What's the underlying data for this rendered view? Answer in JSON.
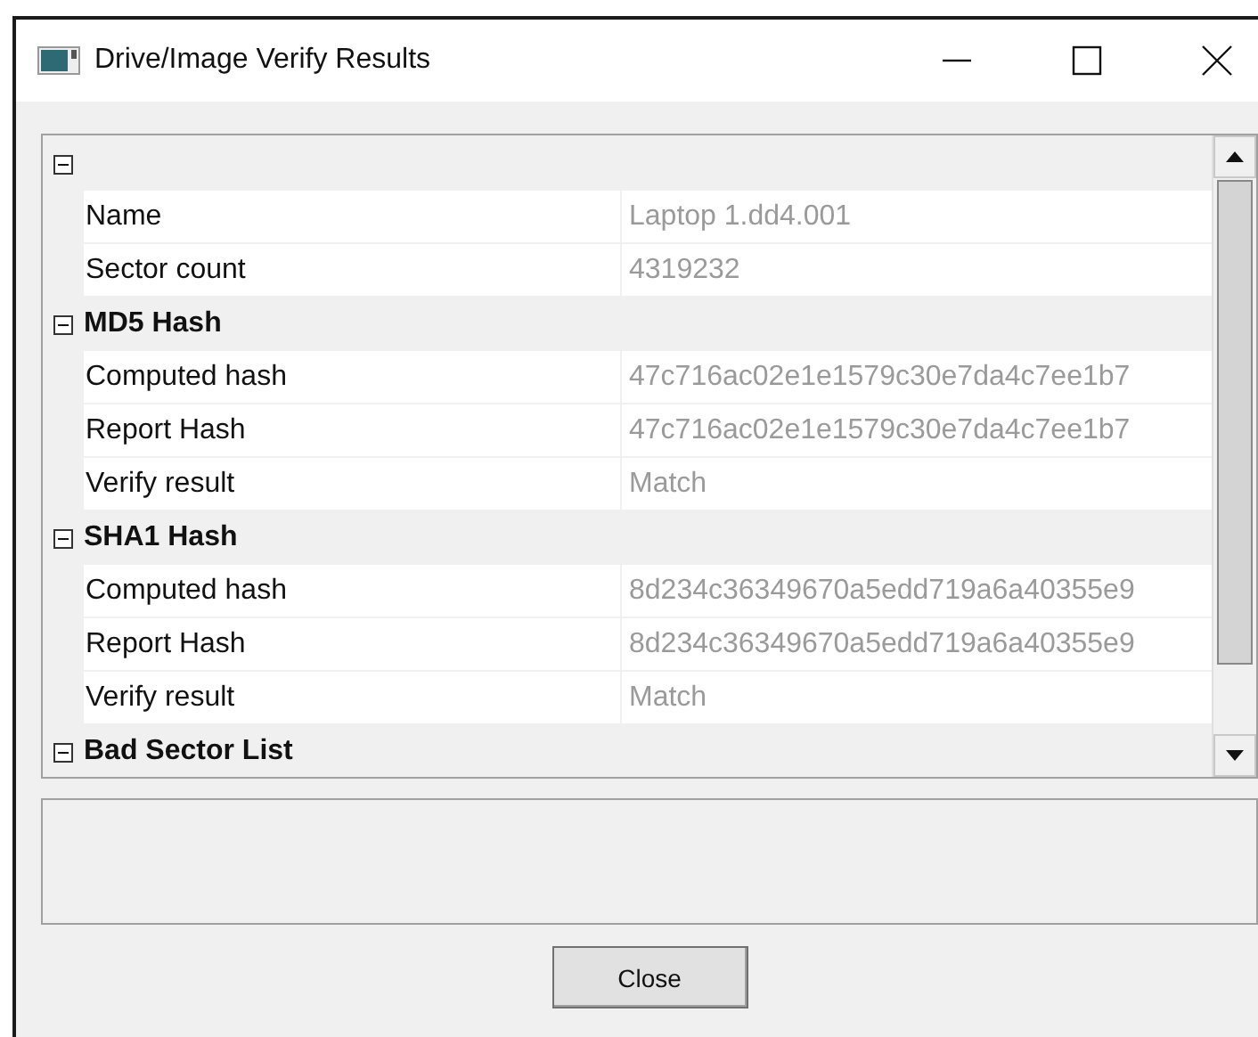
{
  "window": {
    "title": "Drive/Image Verify Results"
  },
  "groups": [
    {
      "expanded": true,
      "rows": [
        {
          "name": "Name",
          "value": "Laptop 1.dd4.001"
        },
        {
          "name": "Sector count",
          "value": "4319232"
        }
      ]
    },
    {
      "title": "MD5 Hash",
      "expanded": true,
      "rows": [
        {
          "name": "Computed hash",
          "value": "47c716ac02e1e1579c30e7da4c7ee1b7"
        },
        {
          "name": "Report Hash",
          "value": "47c716ac02e1e1579c30e7da4c7ee1b7"
        },
        {
          "name": "Verify result",
          "value": "Match"
        }
      ]
    },
    {
      "title": "SHA1 Hash",
      "expanded": true,
      "rows": [
        {
          "name": "Computed hash",
          "value": "8d234c36349670a5edd719a6a40355e9"
        },
        {
          "name": "Report Hash",
          "value": "8d234c36349670a5edd719a6a40355e9"
        },
        {
          "name": "Verify result",
          "value": "Match"
        }
      ]
    },
    {
      "title": "Bad Sector List",
      "expanded": true
    }
  ],
  "buttons": [
    {
      "label": "Close"
    }
  ]
}
